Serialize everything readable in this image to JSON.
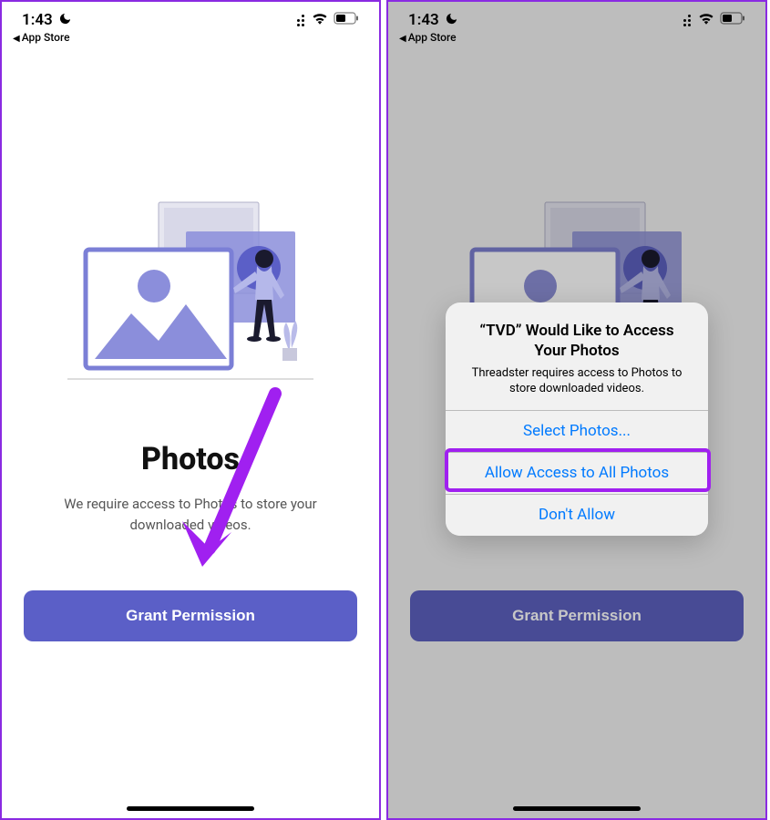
{
  "statusBar": {
    "time": "1:43",
    "backLabel": "App Store"
  },
  "screen": {
    "heading": "Photos",
    "subtext": "We require access to Photos to store your downloaded videos.",
    "grantButton": "Grant Permission"
  },
  "dialog": {
    "title": "“TVD” Would Like to Access Your Photos",
    "description": "Threadster requires access to Photos to store downloaded videos.",
    "optionSelect": "Select Photos...",
    "optionAllowAll": "Allow Access to All Photos",
    "optionDeny": "Don't Allow"
  }
}
